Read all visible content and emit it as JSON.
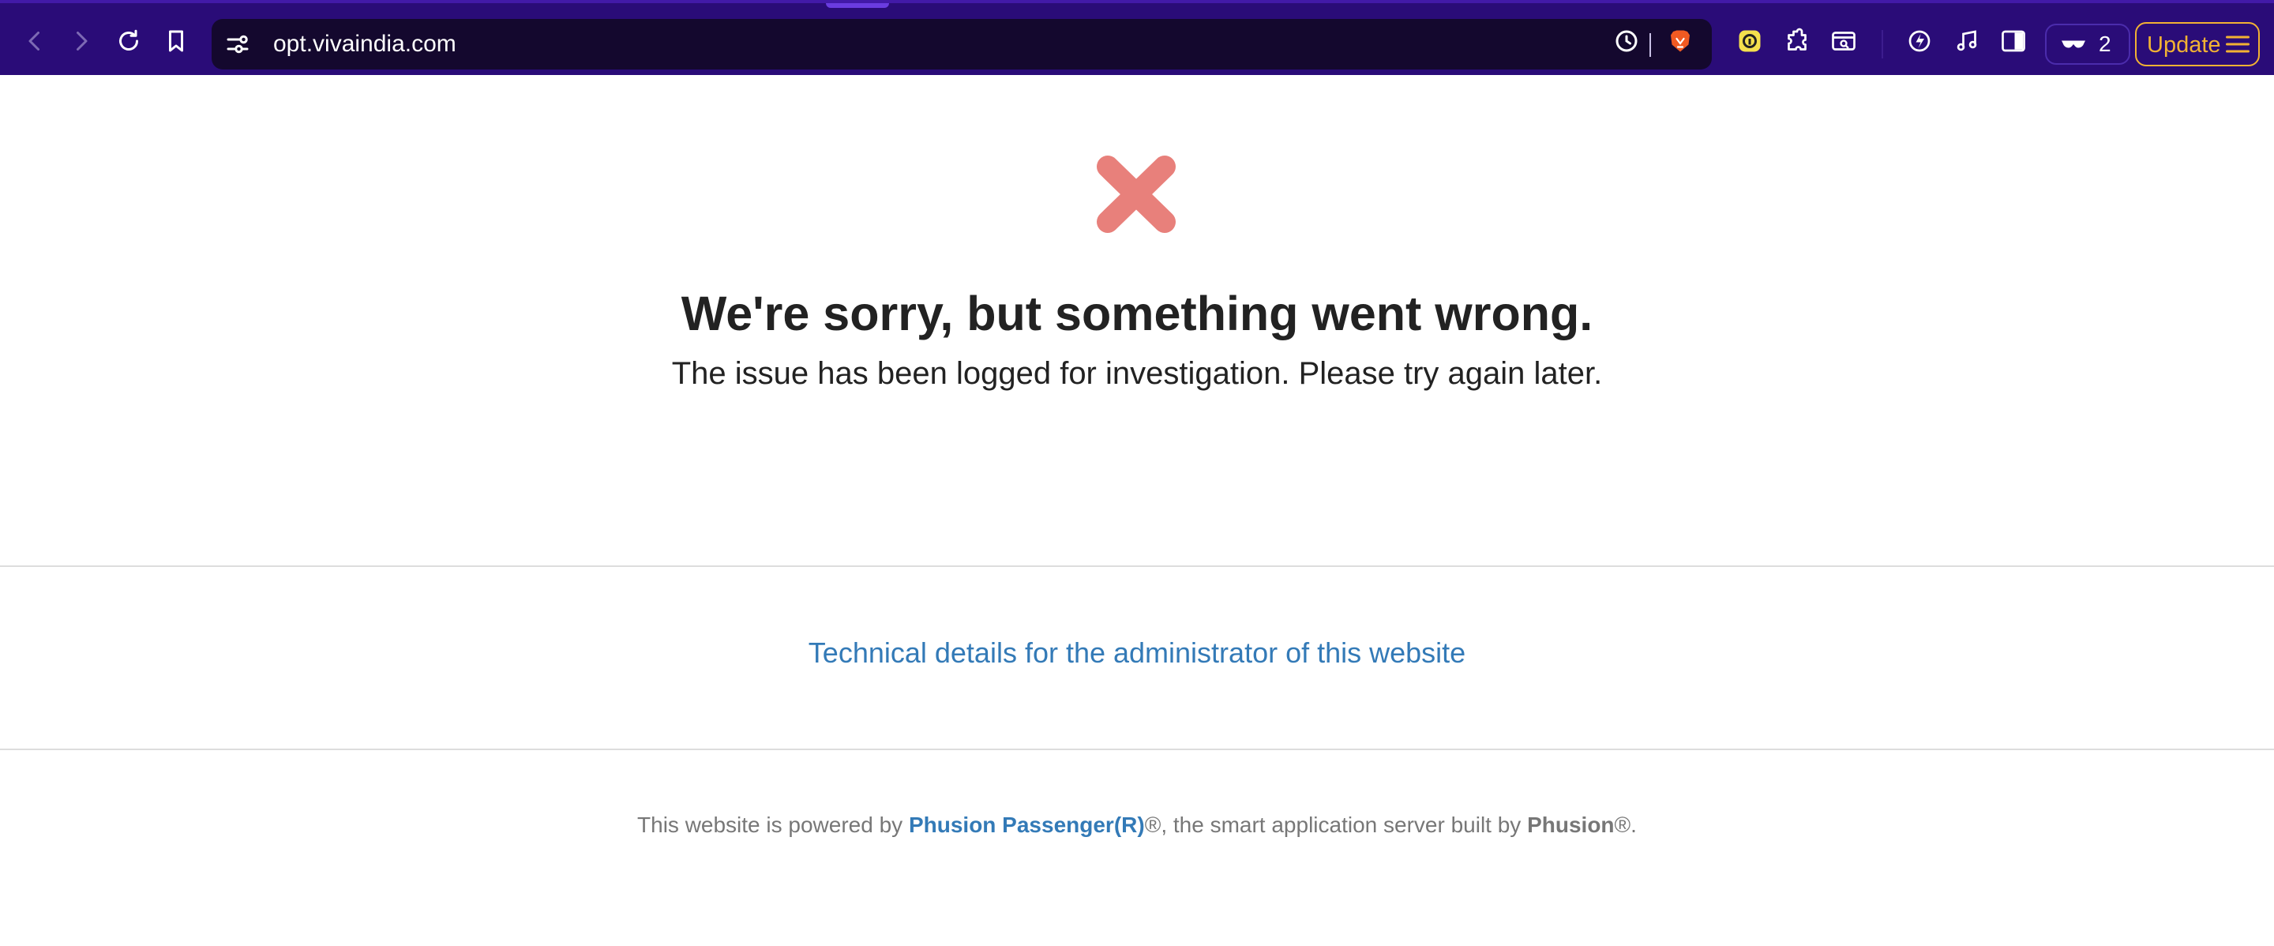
{
  "browser": {
    "url": "opt.vivaindia.com",
    "extension_count": "2",
    "update_label": "Update",
    "colors": {
      "toolbar": "#2a0c78",
      "url_bar": "#14082e",
      "update_accent": "#f2b233"
    },
    "icons": {
      "back": "back-arrow-icon",
      "forward": "forward-arrow-icon",
      "reload": "reload-icon",
      "bookmark": "bookmark-icon",
      "site_settings": "site-settings-icon",
      "history": "history-icon",
      "brave_shields": "brave-lion-icon",
      "extension_yellow": "yellow-extension-icon",
      "extensions": "puzzle-piece-icon",
      "reader": "reader-mode-icon",
      "leo": "leo-ai-icon",
      "media": "music-note-icon",
      "sidebar": "sidebar-toggle-icon",
      "private": "private-glasses-icon",
      "menu": "hamburger-menu-icon"
    }
  },
  "page": {
    "error_icon": "error-x-icon",
    "error_icon_color": "#e8807b",
    "heading": "We're sorry, but something went wrong.",
    "subtext": "The issue has been logged for investigation. Please try again later.",
    "tech_details_link": "Technical details for the administrator of this website",
    "link_color": "#337ab7",
    "footer": {
      "prefix": "This website is powered by ",
      "product_link": "Phusion Passenger(R)",
      "middle": "®, the smart application server built by ",
      "company": "Phusion",
      "suffix": "®."
    }
  }
}
